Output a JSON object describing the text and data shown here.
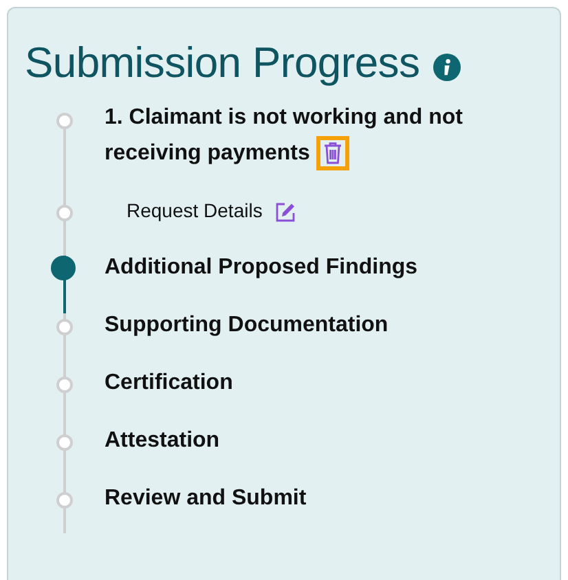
{
  "panel": {
    "title": "Submission Progress",
    "steps": [
      {
        "kind": "step",
        "label": "1. Claimant is not working and not receiving payments",
        "current": false,
        "action": {
          "kind": "delete",
          "focused": true
        }
      },
      {
        "kind": "substep",
        "label": "Request Details",
        "current": false,
        "action": {
          "kind": "edit",
          "focused": false
        }
      },
      {
        "kind": "step",
        "label": "Additional Proposed Findings",
        "current": true
      },
      {
        "kind": "step",
        "label": "Supporting Documentation",
        "current": false
      },
      {
        "kind": "step",
        "label": "Certification",
        "current": false
      },
      {
        "kind": "step",
        "label": "Attestation",
        "current": false
      },
      {
        "kind": "step",
        "label": "Review and Submit",
        "current": false
      }
    ]
  }
}
